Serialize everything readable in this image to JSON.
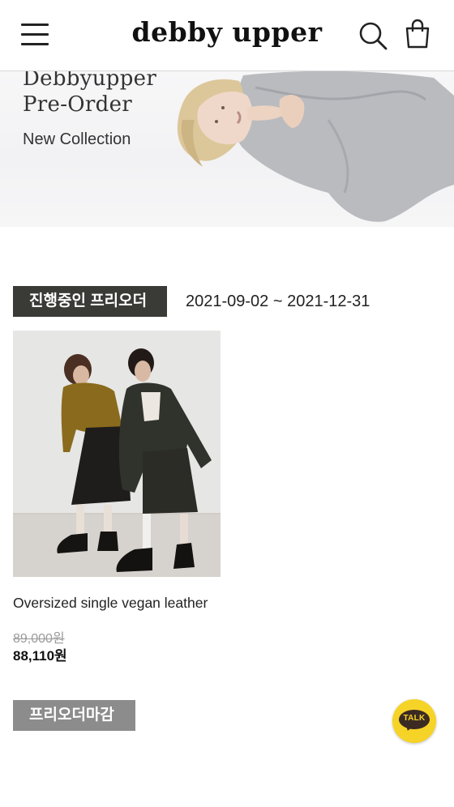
{
  "header": {
    "logo": "debby upper",
    "menu_icon": "hamburger-menu-icon",
    "search_icon": "search-icon",
    "cart_icon": "shopping-bag-icon"
  },
  "banner": {
    "line1": "Debbyupper",
    "line2": "Pre-Order",
    "line3": "New Collection"
  },
  "active_section": {
    "badge": "진행중인 프리오더",
    "period": "2021-09-02 ~ 2021-12-31",
    "products": [
      {
        "name": "Oversized single vegan leather",
        "original_price": "89,000원",
        "sale_price": "88,110원"
      }
    ]
  },
  "closed_section": {
    "badge": "프리오더마감"
  },
  "kakao": {
    "label": "TALK",
    "icon": "kakao-talk-icon",
    "color": "#f6d327"
  },
  "colors": {
    "badge_active": "#3a3a36",
    "badge_closed": "#8c8c8c"
  }
}
